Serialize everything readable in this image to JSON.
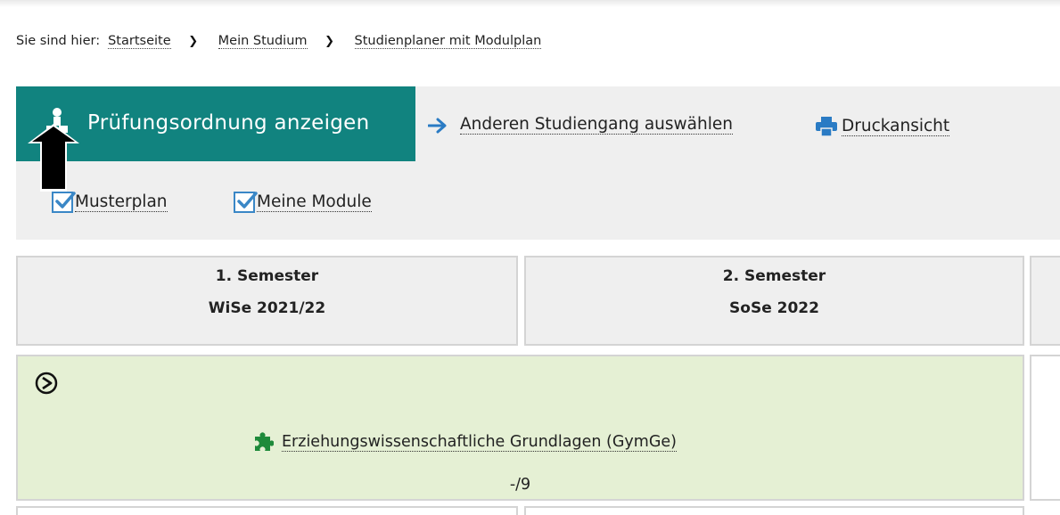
{
  "breadcrumb": {
    "prefix": "Sie sind hier:",
    "items": [
      "Startseite",
      "Mein Studium",
      "Studienplaner mit Modulplan"
    ]
  },
  "toolbar": {
    "primary_label": "Prüfungsordnung anzeigen",
    "switch_program_label": "Anderen Studiengang auswählen",
    "print_label": "Druckansicht",
    "checkboxes": [
      {
        "label": "Musterplan",
        "checked": true
      },
      {
        "label": "Meine Module",
        "checked": true
      }
    ]
  },
  "semesters": [
    {
      "title": "1. Semester",
      "term": "WiSe 2021/22"
    },
    {
      "title": "2. Semester",
      "term": "SoSe 2022"
    }
  ],
  "module": {
    "name": "Erziehungswissenschaftliche Grundlagen (GymGe)",
    "credits": "-/9"
  },
  "colors": {
    "accent": "#11837f",
    "module_bg": "#e5f0d4",
    "link_icon": "#2a7bc4",
    "checkbox": "#3a87c6",
    "puzzle": "#1e8a3a"
  },
  "icons": {
    "primary": "exam-regulations-icon",
    "switch": "arrow-right-icon",
    "print": "printer-icon",
    "expand": "circle-chevron-right-icon",
    "module": "puzzle-piece-icon",
    "overlay": "up-arrow-pointer-icon"
  }
}
